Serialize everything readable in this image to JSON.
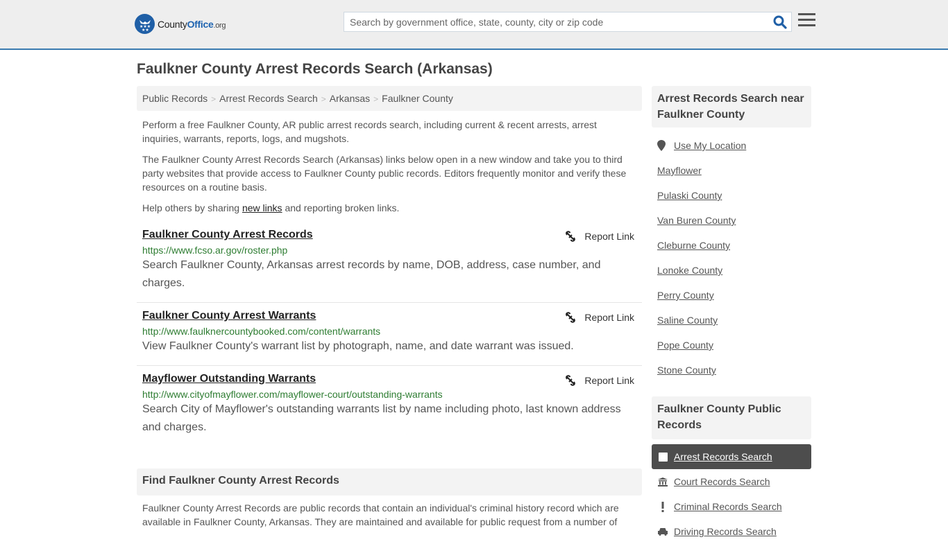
{
  "header": {
    "logo": {
      "county": "County",
      "office": "Office",
      "org": ".org"
    },
    "search": {
      "placeholder": "Search by government office, state, county, city or zip code",
      "value": ""
    },
    "colors": {
      "brand": "#1f5fa6",
      "accent_border": "#3a7bb0"
    }
  },
  "page": {
    "title": "Faulkner County Arrest Records Search (Arkansas)",
    "breadcrumb": [
      "Public Records",
      "Arrest Records Search",
      "Arkansas",
      "Faulkner County"
    ],
    "intro": {
      "p1": "Perform a free Faulkner County, AR public arrest records search, including current & recent arrests, arrest inquiries, warrants, reports, logs, and mugshots.",
      "p2": "The Faulkner County Arrest Records Search (Arkansas) links below open in a new window and take you to third party websites that provide access to Faulkner County public records. Editors frequently monitor and verify these resources on a routine basis.",
      "p3_before": "Help others by sharing ",
      "p3_link": "new links",
      "p3_after": " and reporting broken links."
    },
    "results": [
      {
        "title": "Faulkner County Arrest Records",
        "url": "https://www.fcso.ar.gov/roster.php",
        "description": "Search Faulkner County, Arkansas arrest records by name, DOB, address, case number, and charges.",
        "report_label": "Report Link"
      },
      {
        "title": "Faulkner County Arrest Warrants",
        "url": "http://www.faulknercountybooked.com/content/warrants",
        "description": "View Faulkner County's warrant list by photograph, name, and date warrant was issued.",
        "report_label": "Report Link"
      },
      {
        "title": "Mayflower Outstanding Warrants",
        "url": "http://www.cityofmayflower.com/mayflower-court/outstanding-warrants",
        "description": "Search City of Mayflower's outstanding warrants list by name including photo, last known address and charges.",
        "report_label": "Report Link"
      }
    ],
    "find_section": {
      "heading": "Find Faulkner County Arrest Records",
      "text": "Faulkner County Arrest Records are public records that contain an individual's criminal history record which are available in Faulkner County, Arkansas. They are maintained and available for public request from a number of"
    }
  },
  "sidebar": {
    "nearby": {
      "heading": "Arrest Records Search near Faulkner County",
      "use_location": "Use My Location",
      "links": [
        "Mayflower",
        "Pulaski County",
        "Van Buren County",
        "Cleburne County",
        "Lonoke County",
        "Perry County",
        "Saline County",
        "Pope County",
        "Stone County"
      ]
    },
    "public_records": {
      "heading": "Faulkner County Public Records",
      "items": [
        {
          "label": "Arrest Records Search",
          "icon": "square-icon",
          "active": true
        },
        {
          "label": "Court Records Search",
          "icon": "courthouse-icon",
          "active": false
        },
        {
          "label": "Criminal Records Search",
          "icon": "exclamation-icon",
          "active": false
        },
        {
          "label": "Driving Records Search",
          "icon": "car-icon",
          "active": false
        }
      ]
    }
  }
}
